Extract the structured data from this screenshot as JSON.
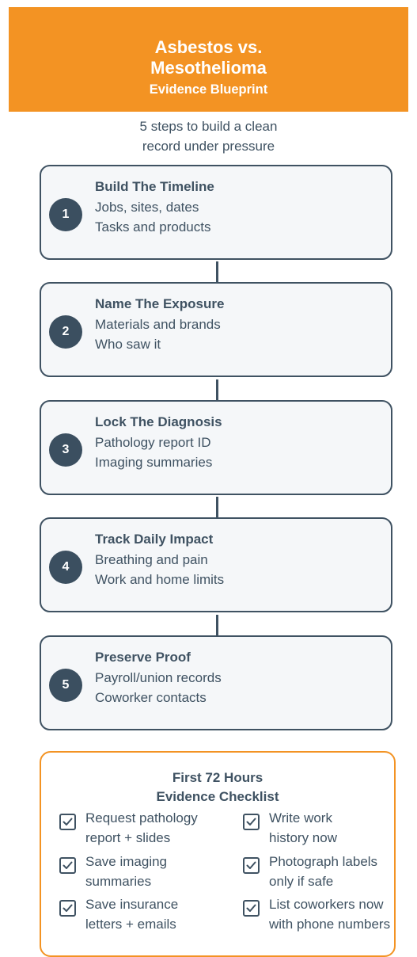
{
  "header": {
    "title_line1": "Asbestos vs.",
    "title_line2": "Mesothelioma",
    "title_line3": "Evidence Blueprint"
  },
  "subtitle": {
    "line1": "5 steps to build a clean",
    "line2": "record under pressure"
  },
  "steps": [
    {
      "number": "1",
      "title": "Build The Timeline",
      "line1": "Jobs, sites, dates",
      "line2": "Tasks and products"
    },
    {
      "number": "2",
      "title": "Name The Exposure",
      "line1": "Materials and brands",
      "line2": "Who saw it"
    },
    {
      "number": "3",
      "title": "Lock The Diagnosis",
      "line1": "Pathology report ID",
      "line2": "Imaging summaries"
    },
    {
      "number": "4",
      "title": "Track Daily Impact",
      "line1": "Breathing and pain",
      "line2": "Work and home limits"
    },
    {
      "number": "5",
      "title": "Preserve Proof",
      "line1": "Payroll/union records",
      "line2": "Coworker contacts"
    }
  ],
  "checklist": {
    "title_line1": "First 72 Hours",
    "title_line2": "Evidence Checklist",
    "items": [
      {
        "line1": "Request pathology",
        "line2": "report + slides"
      },
      {
        "line1": "Write work",
        "line2": "history now"
      },
      {
        "line1": "Save imaging",
        "line2": "summaries"
      },
      {
        "line1": "Photograph labels",
        "line2": "only if safe"
      },
      {
        "line1": "Save insurance",
        "line2": "letters + emails"
      },
      {
        "line1": "List coworkers now",
        "line2": "with phone numbers"
      }
    ]
  },
  "colors": {
    "accent": "#f39323",
    "primary": "#3f5262",
    "card_bg": "#f5f7f9"
  },
  "icons": {
    "checkbox": "checked-box-icon"
  }
}
